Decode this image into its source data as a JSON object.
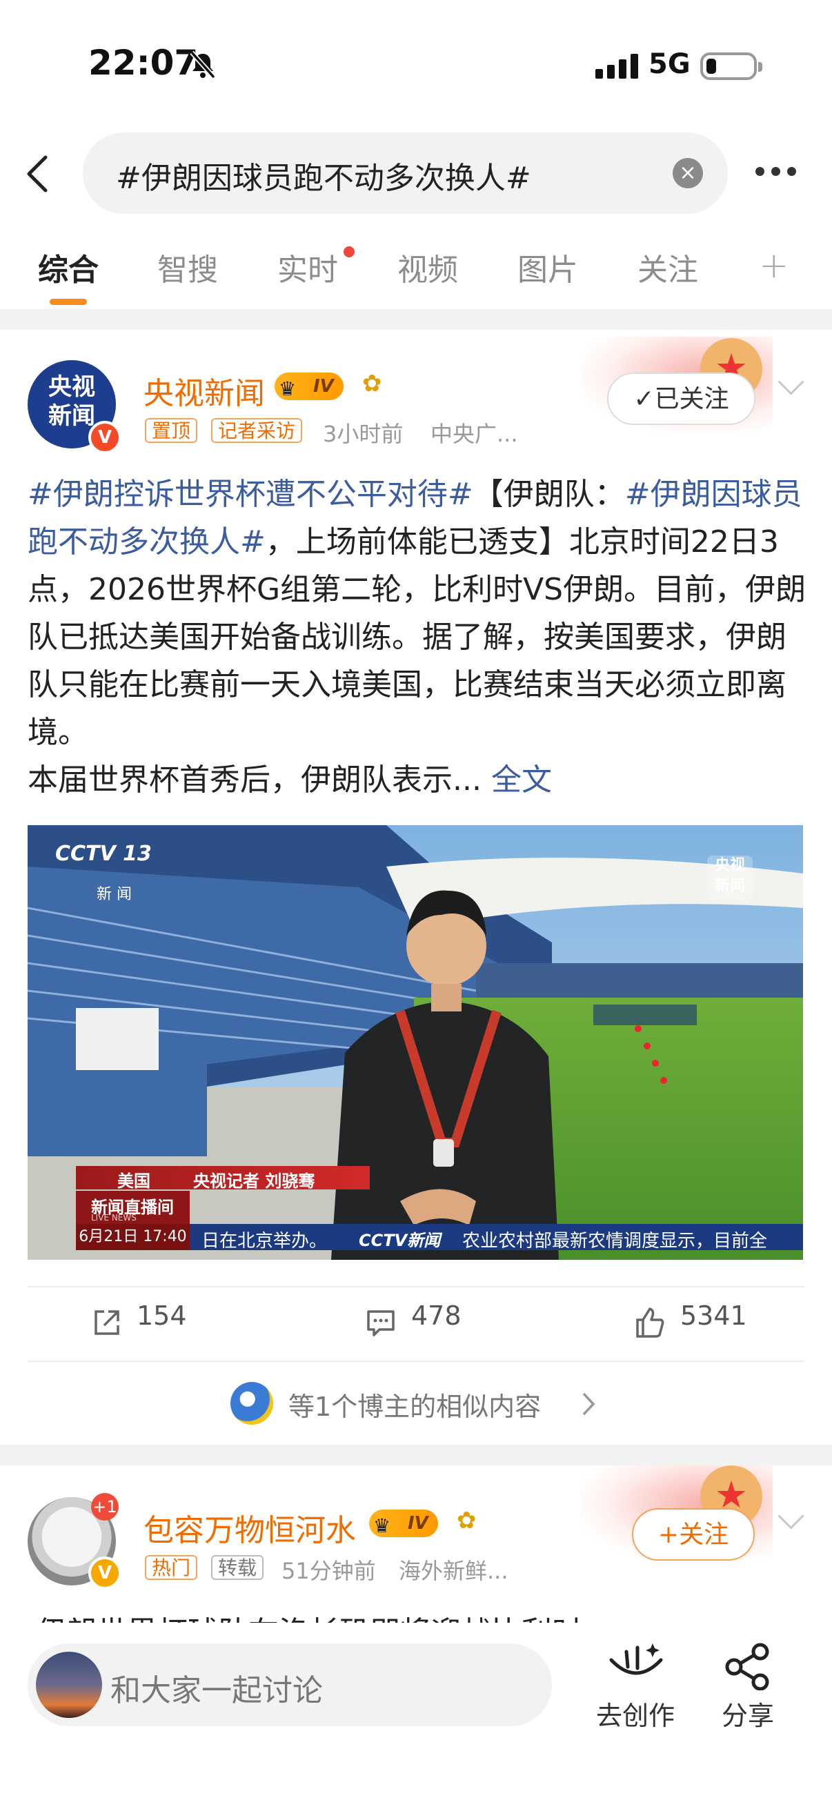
{
  "status_bar": {
    "time": "22:07",
    "network": "5G"
  },
  "search": {
    "query": "#伊朗因球员跑不动多次换人#"
  },
  "tabs": [
    {
      "label": "综合"
    },
    {
      "label": "智搜"
    },
    {
      "label": "实时"
    },
    {
      "label": "视频"
    },
    {
      "label": "图片"
    },
    {
      "label": "关注"
    }
  ],
  "tabs_plus": "+",
  "post1": {
    "avatar_text_line1": "央视",
    "avatar_text_line2": "新闻",
    "username": "央视新闻",
    "level": "IV",
    "tag_pinned": "置顶",
    "tag_interview": "记者采访",
    "time": "3小时前",
    "source": "中央广...",
    "follow_label": "✓已关注",
    "text": {
      "topic1": "#伊朗控诉世界杯遭不公平对待#",
      "part1": "【伊朗队：",
      "topic2": "#伊朗因球员跑不动多次换人#",
      "part2": "，上场前体能已透支】北京时间22日3点，2026世界杯G组第二轮，比利时VS伊朗。目前，伊朗队已抵达美国开始备战训练。据了解，按美国要求，伊朗队只能在比赛前一天入境美国，比赛结束当天必须立即离境。",
      "part3": "本届世界杯首秀后，伊朗队表示...",
      "full_link": "全文"
    },
    "video": {
      "channel": "CCTV 13",
      "channel_sub": "新 闻",
      "logo_line1": "央视",
      "logo_line2": "新闻",
      "lower_location": "美国",
      "lower_reporter": "央视记者 刘骁骞",
      "show_name": "新闻直播间",
      "show_name_en": "LIVE NEWS",
      "datetime": "6月21日 17:40",
      "ticker_left": "日在北京举办。",
      "ticker_logo": "CCTV新闻",
      "ticker_right": "农业农村部最新农情调度显示，目前全"
    },
    "reposts": "154",
    "comments": "478",
    "likes": "5341",
    "similar": "等1个博主的相似内容"
  },
  "post2": {
    "username": "包容万物恒河水",
    "level": "IV",
    "plus_badge": "+1",
    "tag_hot": "热门",
    "tag_repost": "转载",
    "time": "51分钟前",
    "source": "海外新鲜...",
    "follow_label": "+关注",
    "text_preview": "伊朗世界杯球队在洛杉矶即将迎战比利时"
  },
  "bottom_bar": {
    "comment_placeholder": "和大家一起讨论",
    "create_label": "去创作",
    "share_label": "分享"
  }
}
